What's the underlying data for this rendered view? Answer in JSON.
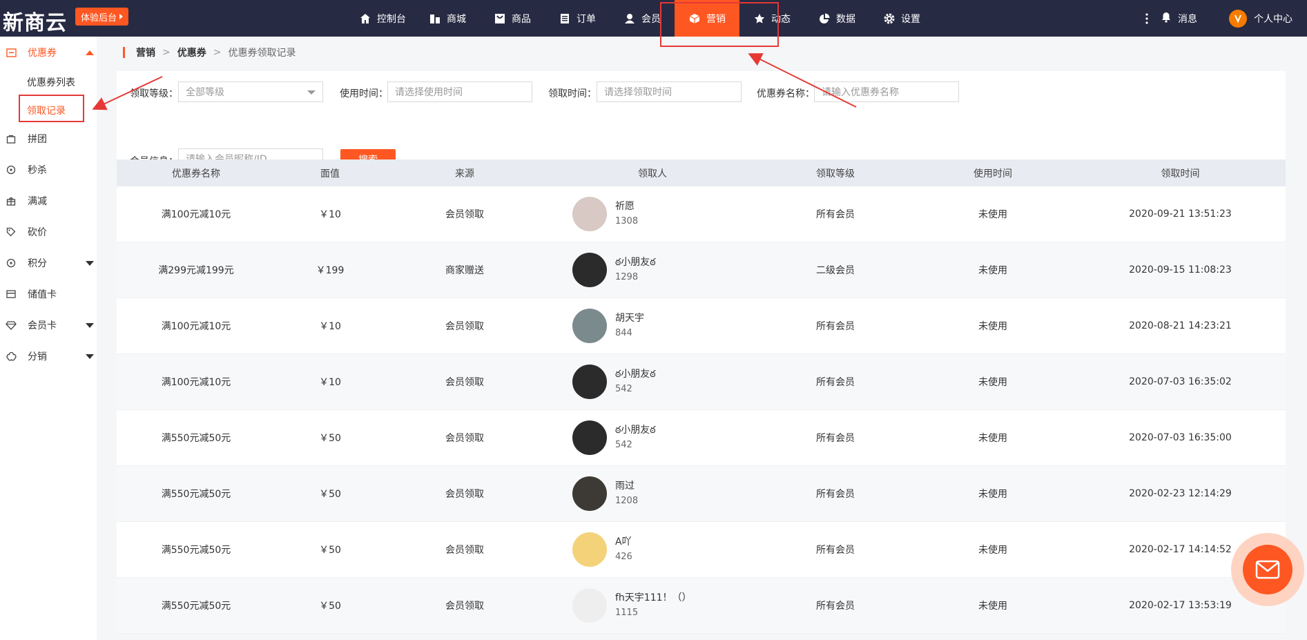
{
  "header": {
    "logo": "新商云",
    "trial_label": "体验后台",
    "nav": [
      {
        "label": "控制台",
        "icon": "home-icon"
      },
      {
        "label": "商城",
        "icon": "store-icon"
      },
      {
        "label": "商品",
        "icon": "goods-icon"
      },
      {
        "label": "订单",
        "icon": "order-icon"
      },
      {
        "label": "会员",
        "icon": "user-icon"
      },
      {
        "label": "营销",
        "icon": "cube-icon",
        "active": true
      },
      {
        "label": "动态",
        "icon": "star-icon"
      },
      {
        "label": "数据",
        "icon": "pie-chart-icon"
      },
      {
        "label": "设置",
        "icon": "gear-icon"
      }
    ],
    "messages_label": "消息",
    "profile_label": "个人中心"
  },
  "sidebar": {
    "group_coupon": "优惠券",
    "sub_coupon_list": "优惠券列表",
    "sub_claim_records": "领取记录",
    "items": [
      {
        "label": "拼团",
        "icon": "bag-icon"
      },
      {
        "label": "秒杀",
        "icon": "clock-icon"
      },
      {
        "label": "满减",
        "icon": "gift-icon"
      },
      {
        "label": "砍价",
        "icon": "tag-icon"
      },
      {
        "label": "积分",
        "icon": "coin-icon",
        "caret": true
      },
      {
        "label": "储值卡",
        "icon": "card-icon"
      },
      {
        "label": "会员卡",
        "icon": "diamond-icon",
        "caret": true
      },
      {
        "label": "分销",
        "icon": "share-icon",
        "caret": true
      }
    ]
  },
  "breadcrumb": [
    "营销",
    "优惠券",
    "优惠券领取记录"
  ],
  "breadcrumb_sep": ">",
  "filters": {
    "level_label": "领取等级：",
    "level_value": "全部等级",
    "use_time_label": "使用时间：",
    "use_time_placeholder": "请选择使用时间",
    "claim_time_label": "领取时间：",
    "claim_time_placeholder": "请选择领取时间",
    "coupon_name_label": "优惠券名称：",
    "coupon_name_placeholder": "请输入优惠券名称",
    "member_label": "会员信息：",
    "member_placeholder": "请输入会员昵称/ID",
    "search_label": "搜索"
  },
  "table": {
    "headers": [
      "优惠券名称",
      "面值",
      "来源",
      "领取人",
      "领取等级",
      "使用时间",
      "领取时间"
    ],
    "rows": [
      {
        "name": "满100元减10元",
        "value": "￥10",
        "source": "会员领取",
        "user": "祈愿",
        "uid": "1308",
        "level": "所有会员",
        "used": "未使用",
        "time": "2020-09-21 13:51:23",
        "avatar_color": "#d8c9c4"
      },
      {
        "name": "满299元减199元",
        "value": "￥199",
        "source": "商家赠送",
        "user": "ఠ小朋友ఠ",
        "uid": "1298",
        "level": "二级会员",
        "used": "未使用",
        "time": "2020-09-15 11:08:23",
        "avatar_color": "#2b2b2b"
      },
      {
        "name": "满100元减10元",
        "value": "￥10",
        "source": "会员领取",
        "user": "胡天宇",
        "uid": "844",
        "level": "所有会员",
        "used": "未使用",
        "time": "2020-08-21 14:23:21",
        "avatar_color": "#7b8a8c"
      },
      {
        "name": "满100元减10元",
        "value": "￥10",
        "source": "会员领取",
        "user": "ఠ小朋友ఠ",
        "uid": "542",
        "level": "所有会员",
        "used": "未使用",
        "time": "2020-07-03 16:35:02",
        "avatar_color": "#2b2b2b"
      },
      {
        "name": "满550元减50元",
        "value": "￥50",
        "source": "会员领取",
        "user": "ఠ小朋友ఠ",
        "uid": "542",
        "level": "所有会员",
        "used": "未使用",
        "time": "2020-07-03 16:35:00",
        "avatar_color": "#2b2b2b"
      },
      {
        "name": "满550元减50元",
        "value": "￥50",
        "source": "会员领取",
        "user": "雨过",
        "uid": "1208",
        "level": "所有会员",
        "used": "未使用",
        "time": "2020-02-23 12:14:29",
        "avatar_color": "#3d3a36"
      },
      {
        "name": "满550元减50元",
        "value": "￥50",
        "source": "会员领取",
        "user": "A吖",
        "uid": "426",
        "level": "所有会员",
        "used": "未使用",
        "time": "2020-02-17 14:14:52",
        "avatar_color": "#f3d27a"
      },
      {
        "name": "满550元减50元",
        "value": "￥50",
        "source": "会员领取",
        "user": "fh天宇111！（）",
        "uid": "1115",
        "level": "所有会员",
        "used": "未使用",
        "time": "2020-02-17 13:53:19",
        "avatar_color": "#eeeeee"
      }
    ]
  },
  "colors": {
    "accent": "#ff5722",
    "topbar": "#272a43",
    "annotation": "#e53935"
  }
}
